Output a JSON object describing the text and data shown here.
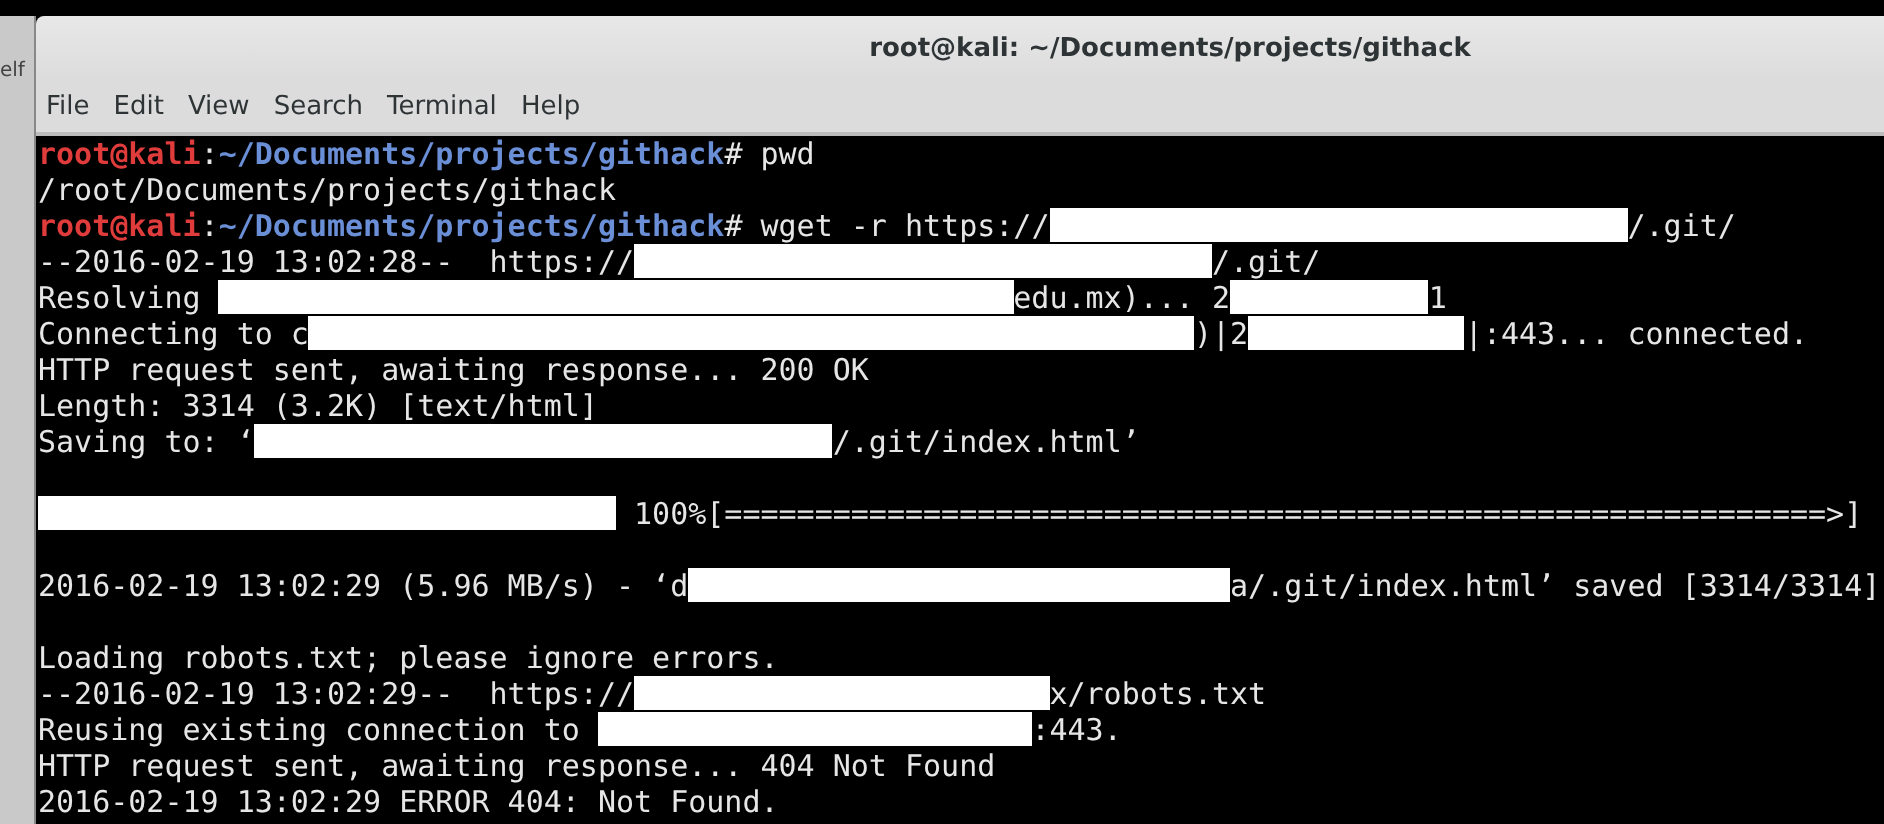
{
  "background_window": {
    "text": "elf"
  },
  "window": {
    "title": "root@kali: ~/Documents/projects/githack"
  },
  "menu": [
    "File",
    "Edit",
    "View",
    "Search",
    "Terminal",
    "Help"
  ],
  "terminal": {
    "lines": [
      {
        "kind": "output",
        "segments": [
          {
            "kind": "user",
            "text": "root@kali"
          },
          {
            "kind": "text",
            "text": ":"
          },
          {
            "kind": "path",
            "text": "~/Documents/projects/githack"
          },
          {
            "kind": "text",
            "text": "# pwd"
          }
        ]
      },
      {
        "kind": "output",
        "segments": [
          {
            "kind": "text",
            "text": "/root/Documents/projects/githack"
          }
        ]
      },
      {
        "kind": "output",
        "segments": [
          {
            "kind": "user",
            "text": "root@kali"
          },
          {
            "kind": "text",
            "text": ":"
          },
          {
            "kind": "path",
            "text": "~/Documents/projects/githack"
          },
          {
            "kind": "text",
            "text": "# wget -r https://"
          },
          {
            "kind": "redacted"
          },
          {
            "kind": "text",
            "text": "/.git/"
          }
        ]
      },
      {
        "kind": "output",
        "segments": [
          {
            "kind": "text",
            "text": "--2016-02-19 13:02:28--  https://"
          },
          {
            "kind": "redacted"
          },
          {
            "kind": "text",
            "text": "/.git/"
          }
        ]
      },
      {
        "kind": "output",
        "segments": [
          {
            "kind": "text",
            "text": "Resolving "
          },
          {
            "kind": "redacted"
          },
          {
            "kind": "text",
            "text": "edu.mx)... 2"
          },
          {
            "kind": "redacted"
          },
          {
            "kind": "text",
            "text": "1"
          }
        ]
      },
      {
        "kind": "output",
        "segments": [
          {
            "kind": "text",
            "text": "Connecting to c"
          },
          {
            "kind": "redacted"
          },
          {
            "kind": "text",
            "text": ")|2"
          },
          {
            "kind": "redacted"
          },
          {
            "kind": "text",
            "text": "|:443... connected."
          }
        ]
      },
      {
        "kind": "output",
        "segments": [
          {
            "kind": "text",
            "text": "HTTP request sent, awaiting response... 200 OK"
          }
        ]
      },
      {
        "kind": "output",
        "segments": [
          {
            "kind": "text",
            "text": "Length: 3314 (3.2K) [text/html]"
          }
        ]
      },
      {
        "kind": "output",
        "segments": [
          {
            "kind": "text",
            "text": "Saving to: ‘"
          },
          {
            "kind": "redacted"
          },
          {
            "kind": "text",
            "text": "/.git/index.html’"
          }
        ]
      },
      {
        "kind": "blank"
      },
      {
        "kind": "output",
        "segments": [
          {
            "kind": "redacted"
          },
          {
            "kind": "text",
            "text": " 100%[=============================================================>]"
          }
        ]
      },
      {
        "kind": "blank"
      },
      {
        "kind": "output",
        "segments": [
          {
            "kind": "text",
            "text": "2016-02-19 13:02:29 (5.96 MB/s) - ‘d"
          },
          {
            "kind": "redacted"
          },
          {
            "kind": "text",
            "text": "a/.git/index.html’ saved [3314/3314]"
          }
        ]
      },
      {
        "kind": "blank"
      },
      {
        "kind": "output",
        "segments": [
          {
            "kind": "text",
            "text": "Loading robots.txt; please ignore errors."
          }
        ]
      },
      {
        "kind": "output",
        "segments": [
          {
            "kind": "text",
            "text": "--2016-02-19 13:02:29--  https://"
          },
          {
            "kind": "redacted"
          },
          {
            "kind": "text",
            "text": "x/robots.txt"
          }
        ]
      },
      {
        "kind": "output",
        "segments": [
          {
            "kind": "text",
            "text": "Reusing existing connection to "
          },
          {
            "kind": "redacted"
          },
          {
            "kind": "text",
            "text": ":443."
          }
        ]
      },
      {
        "kind": "output",
        "segments": [
          {
            "kind": "text",
            "text": "HTTP request sent, awaiting response... 404 Not Found"
          }
        ]
      },
      {
        "kind": "output",
        "segments": [
          {
            "kind": "text",
            "text": "2016-02-19 13:02:29 ERROR 404: Not Found."
          }
        ]
      }
    ]
  }
}
